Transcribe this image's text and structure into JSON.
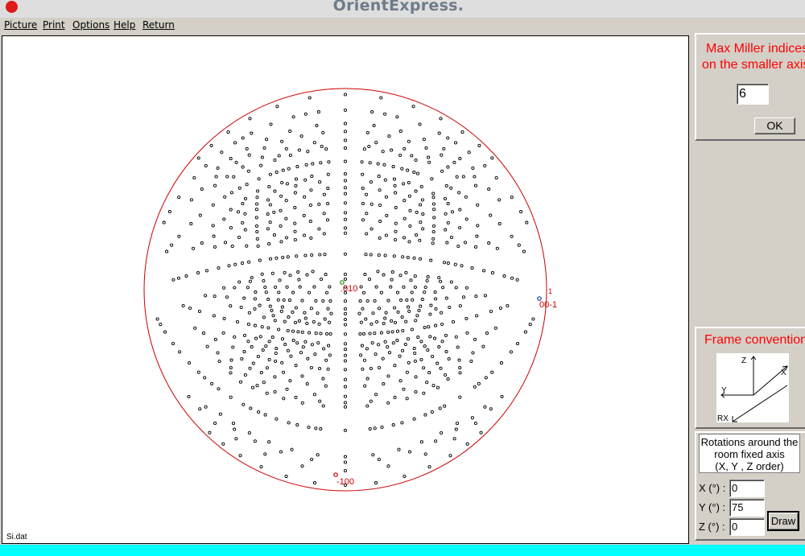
{
  "window": {
    "title": "OrientExpress."
  },
  "menu": [
    "Picture",
    "Print",
    "Options",
    "Help",
    "Return"
  ],
  "projection": {
    "filename": "Si.dat",
    "labels": [
      {
        "text": ".010",
        "color": "#cc0000"
      },
      {
        "text": "00-1",
        "color": "#cc0000"
      },
      {
        "text": "1",
        "color": "#cc0000"
      },
      {
        "text": "-100",
        "color": "#cc0000"
      }
    ],
    "circle_color": "#cc0000",
    "pole_color": "#000000"
  },
  "miller": {
    "title_line1": "Max Miller indices",
    "title_line2": "on the smaller axis",
    "value": "6",
    "ok_label": "OK"
  },
  "frame": {
    "title": "Frame convention",
    "axes": {
      "z": "Z",
      "x": "X",
      "y": "Y",
      "rx": "RX"
    }
  },
  "rotations": {
    "line1": "Rotations around the",
    "line2": "room fixed axis",
    "line3": "(X,  Y , Z order)",
    "x_label": "X  (°) :",
    "y_label": "Y  (°) :",
    "z_label": "Z  (°) :",
    "x_value": "0",
    "y_value": "75",
    "z_value": "0",
    "draw_label": "Draw"
  },
  "colors": {
    "accent_red": "#ff0000",
    "status_bar": "#00ffff",
    "close_button": "#e01a1a"
  }
}
